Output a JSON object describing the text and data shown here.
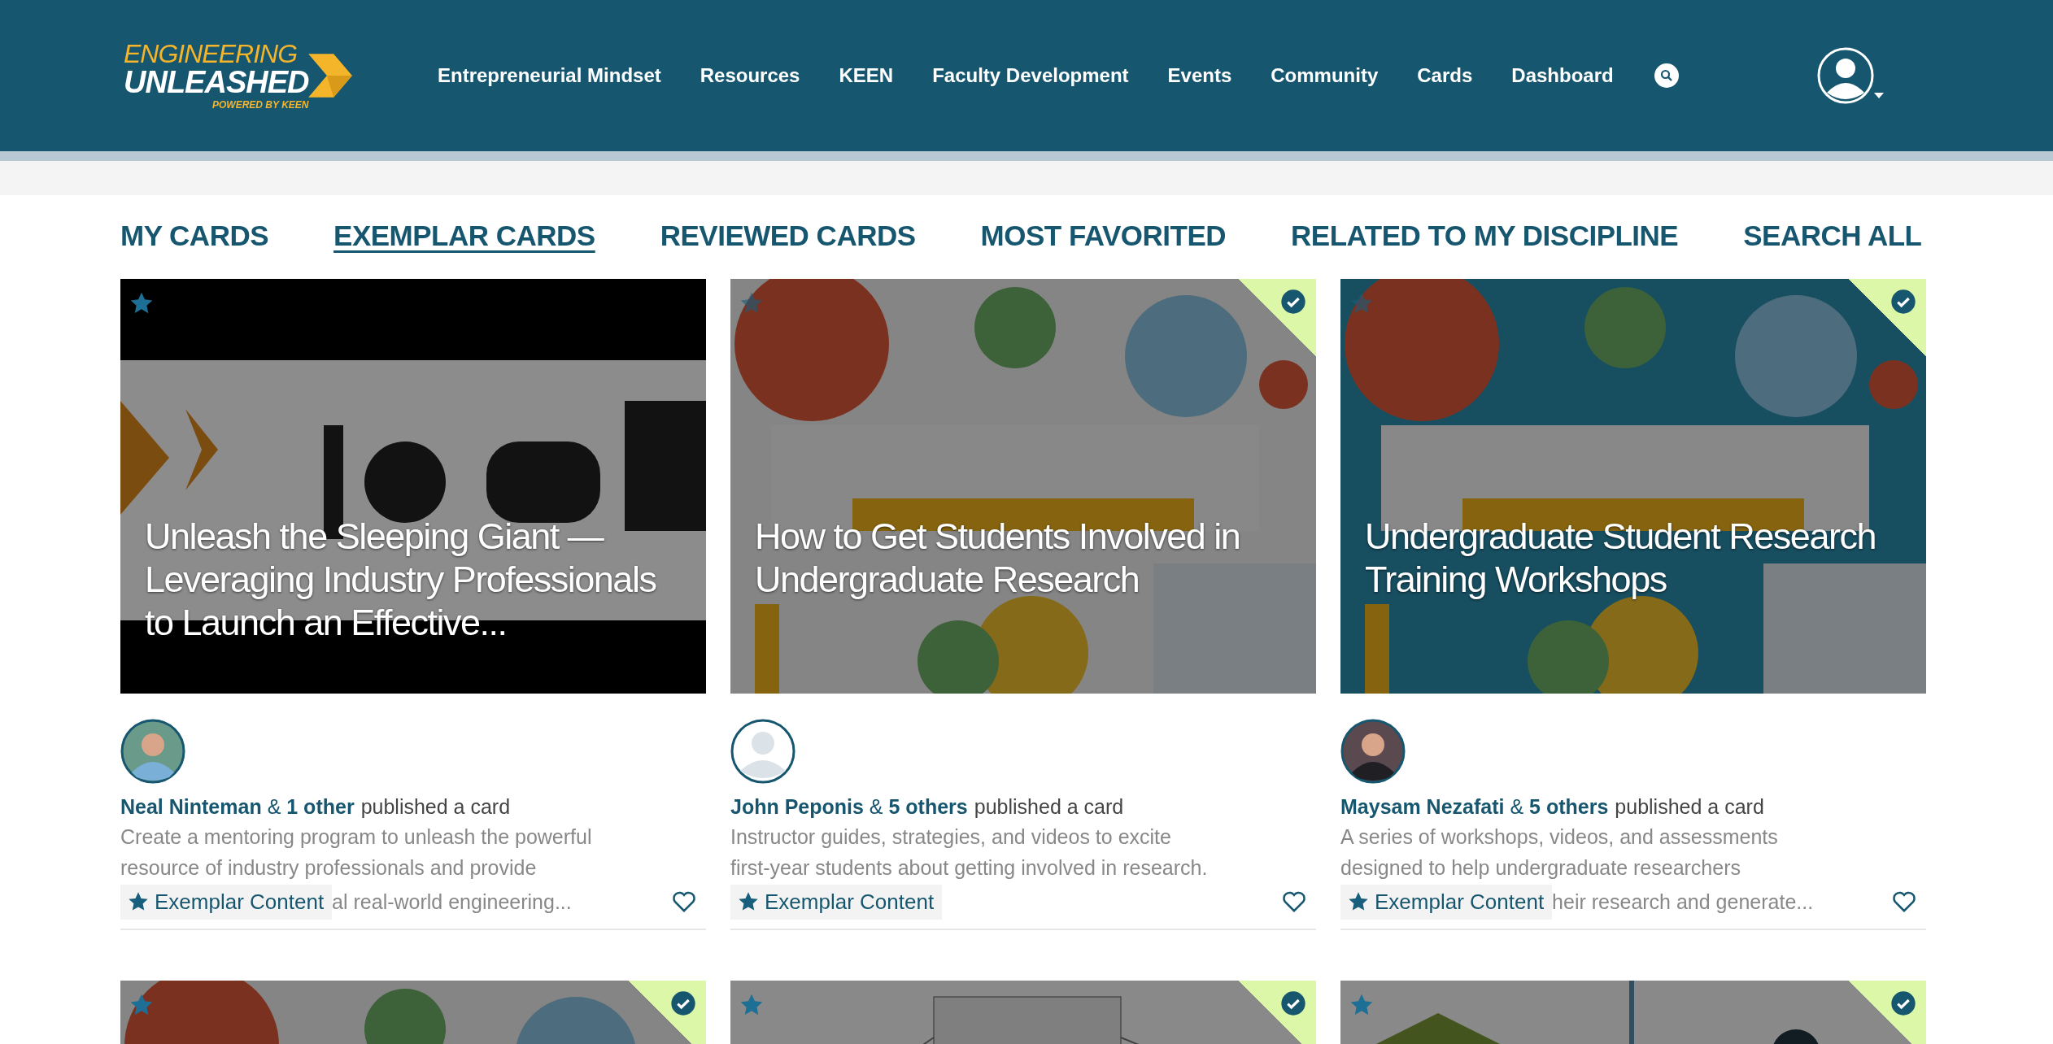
{
  "logo": {
    "line1": "ENGINEERING",
    "line2": "UNLEASHED",
    "tagline": "POWERED BY KEEN"
  },
  "nav": [
    "Entrepreneurial Mindset",
    "Resources",
    "KEEN",
    "Faculty Development",
    "Events",
    "Community",
    "Cards",
    "Dashboard"
  ],
  "tabs": [
    {
      "label": "MY CARDS",
      "selected": false
    },
    {
      "label": "EXEMPLAR CARDS",
      "selected": true
    },
    {
      "label": "REVIEWED CARDS",
      "selected": false
    },
    {
      "label": "MOST FAVORITED",
      "selected": false
    },
    {
      "label": "RELATED TO MY DISCIPLINE",
      "selected": false
    },
    {
      "label": "SEARCH ALL",
      "selected": false
    }
  ],
  "cards": [
    {
      "title": "Unleash the Sleeping Giant — Leveraging Industry Professionals to Launch an Effective...",
      "starred": true,
      "verified": false,
      "author": "Neal Ninteman",
      "joiner": "&",
      "others": "1 other",
      "action": "published a card",
      "description": [
        "Create a mentoring program to unleash the powerful",
        "resource of industry professionals and provide",
        "al real-world engineering..."
      ],
      "badge": "Exemplar Content",
      "favorited": false
    },
    {
      "title": "How to Get Students Involved in Undergraduate Research",
      "starred": false,
      "verified": true,
      "author": "John Peponis",
      "joiner": "&",
      "others": "5 others",
      "action": "published a card",
      "description": [
        "Instructor guides, strategies, and videos to excite",
        "first-year students about getting involved in research."
      ],
      "badge": "Exemplar Content",
      "favorited": false
    },
    {
      "title": "Undergraduate Student Research Training Workshops",
      "starred": false,
      "verified": true,
      "author": "Maysam Nezafati",
      "joiner": "&",
      "others": "5 others",
      "action": "published a card",
      "description": [
        "A series of workshops, videos, and assessments",
        "designed to help undergraduate researchers",
        "heir research and generate..."
      ],
      "badge": "Exemplar Content",
      "favorited": false
    },
    {
      "starred": true,
      "verified": true
    },
    {
      "starred": true,
      "verified": true
    },
    {
      "starred": true,
      "verified": true
    }
  ]
}
